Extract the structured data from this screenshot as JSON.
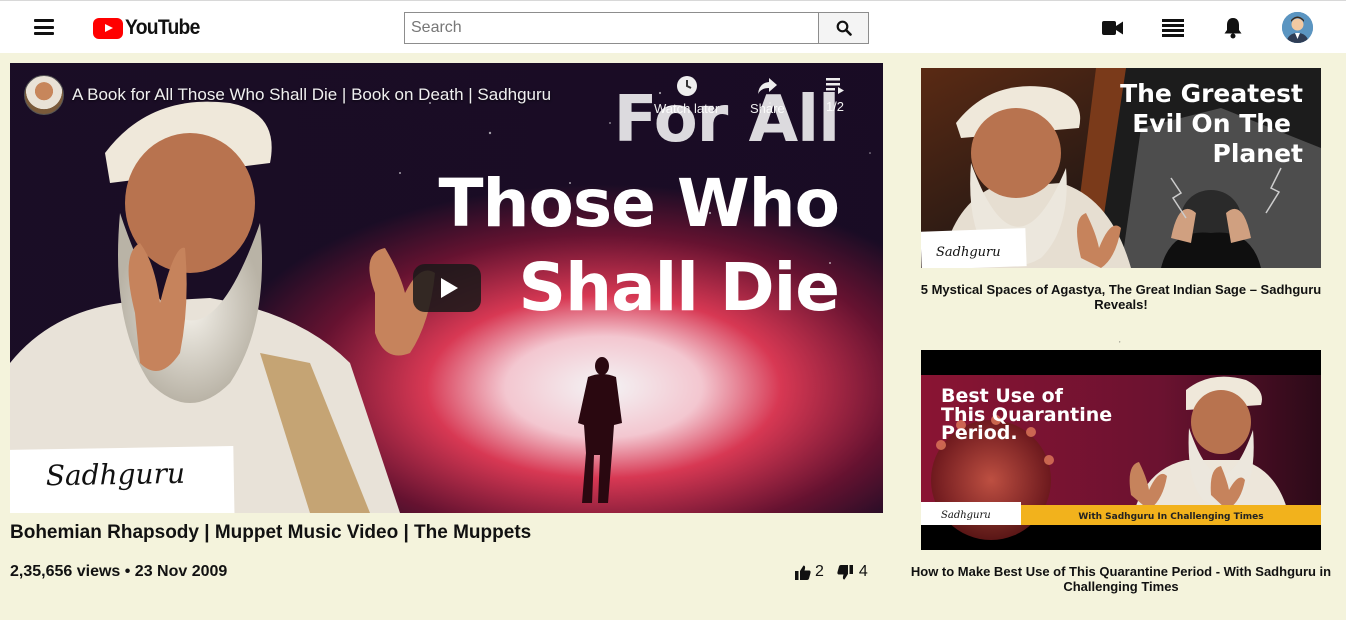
{
  "header": {
    "logo_text": "YouTube",
    "search_placeholder": "Search",
    "search_value": ""
  },
  "player": {
    "video_title": "A Book for All Those Who Shall Die | Book on Death | Sadhguru",
    "watch_later_label": "Watch later",
    "share_label": "Share",
    "playlist_label": "1/2",
    "overlay_line1": "For All",
    "overlay_line2": "Those Who",
    "overlay_line3": "Shall Die",
    "signature": "Sadhguru"
  },
  "main": {
    "title": "Bohemian Rhapsody | Muppet Music Video | The Muppets",
    "views_date": "2,35,656 views • 23 Nov 2009",
    "likes": "2",
    "dislikes": "4"
  },
  "sidebar": {
    "items": [
      {
        "thumb_text": "The Greatest Evil On The Planet",
        "thumb_line1": "The Greatest",
        "thumb_line2": "Evil On The",
        "thumb_line3": "Planet",
        "signature": "Sadhguru",
        "title": "5 Mystical Spaces of Agastya, The Great Indian Sage – Sadhguru Reveals!"
      },
      {
        "thumb_line1": "Best Use of",
        "thumb_line2": "This Quarantine",
        "thumb_line3": "Period.",
        "banner": "With Sadhguru In Challenging Times",
        "signature": "Sadhguru",
        "title": "How to Make Best Use of This Quarantine Period - With Sadhguru in Challenging Times"
      }
    ],
    "separator": ","
  },
  "colors": {
    "page_bg": "#f4f3dc",
    "brand_red": "#ff0000"
  }
}
